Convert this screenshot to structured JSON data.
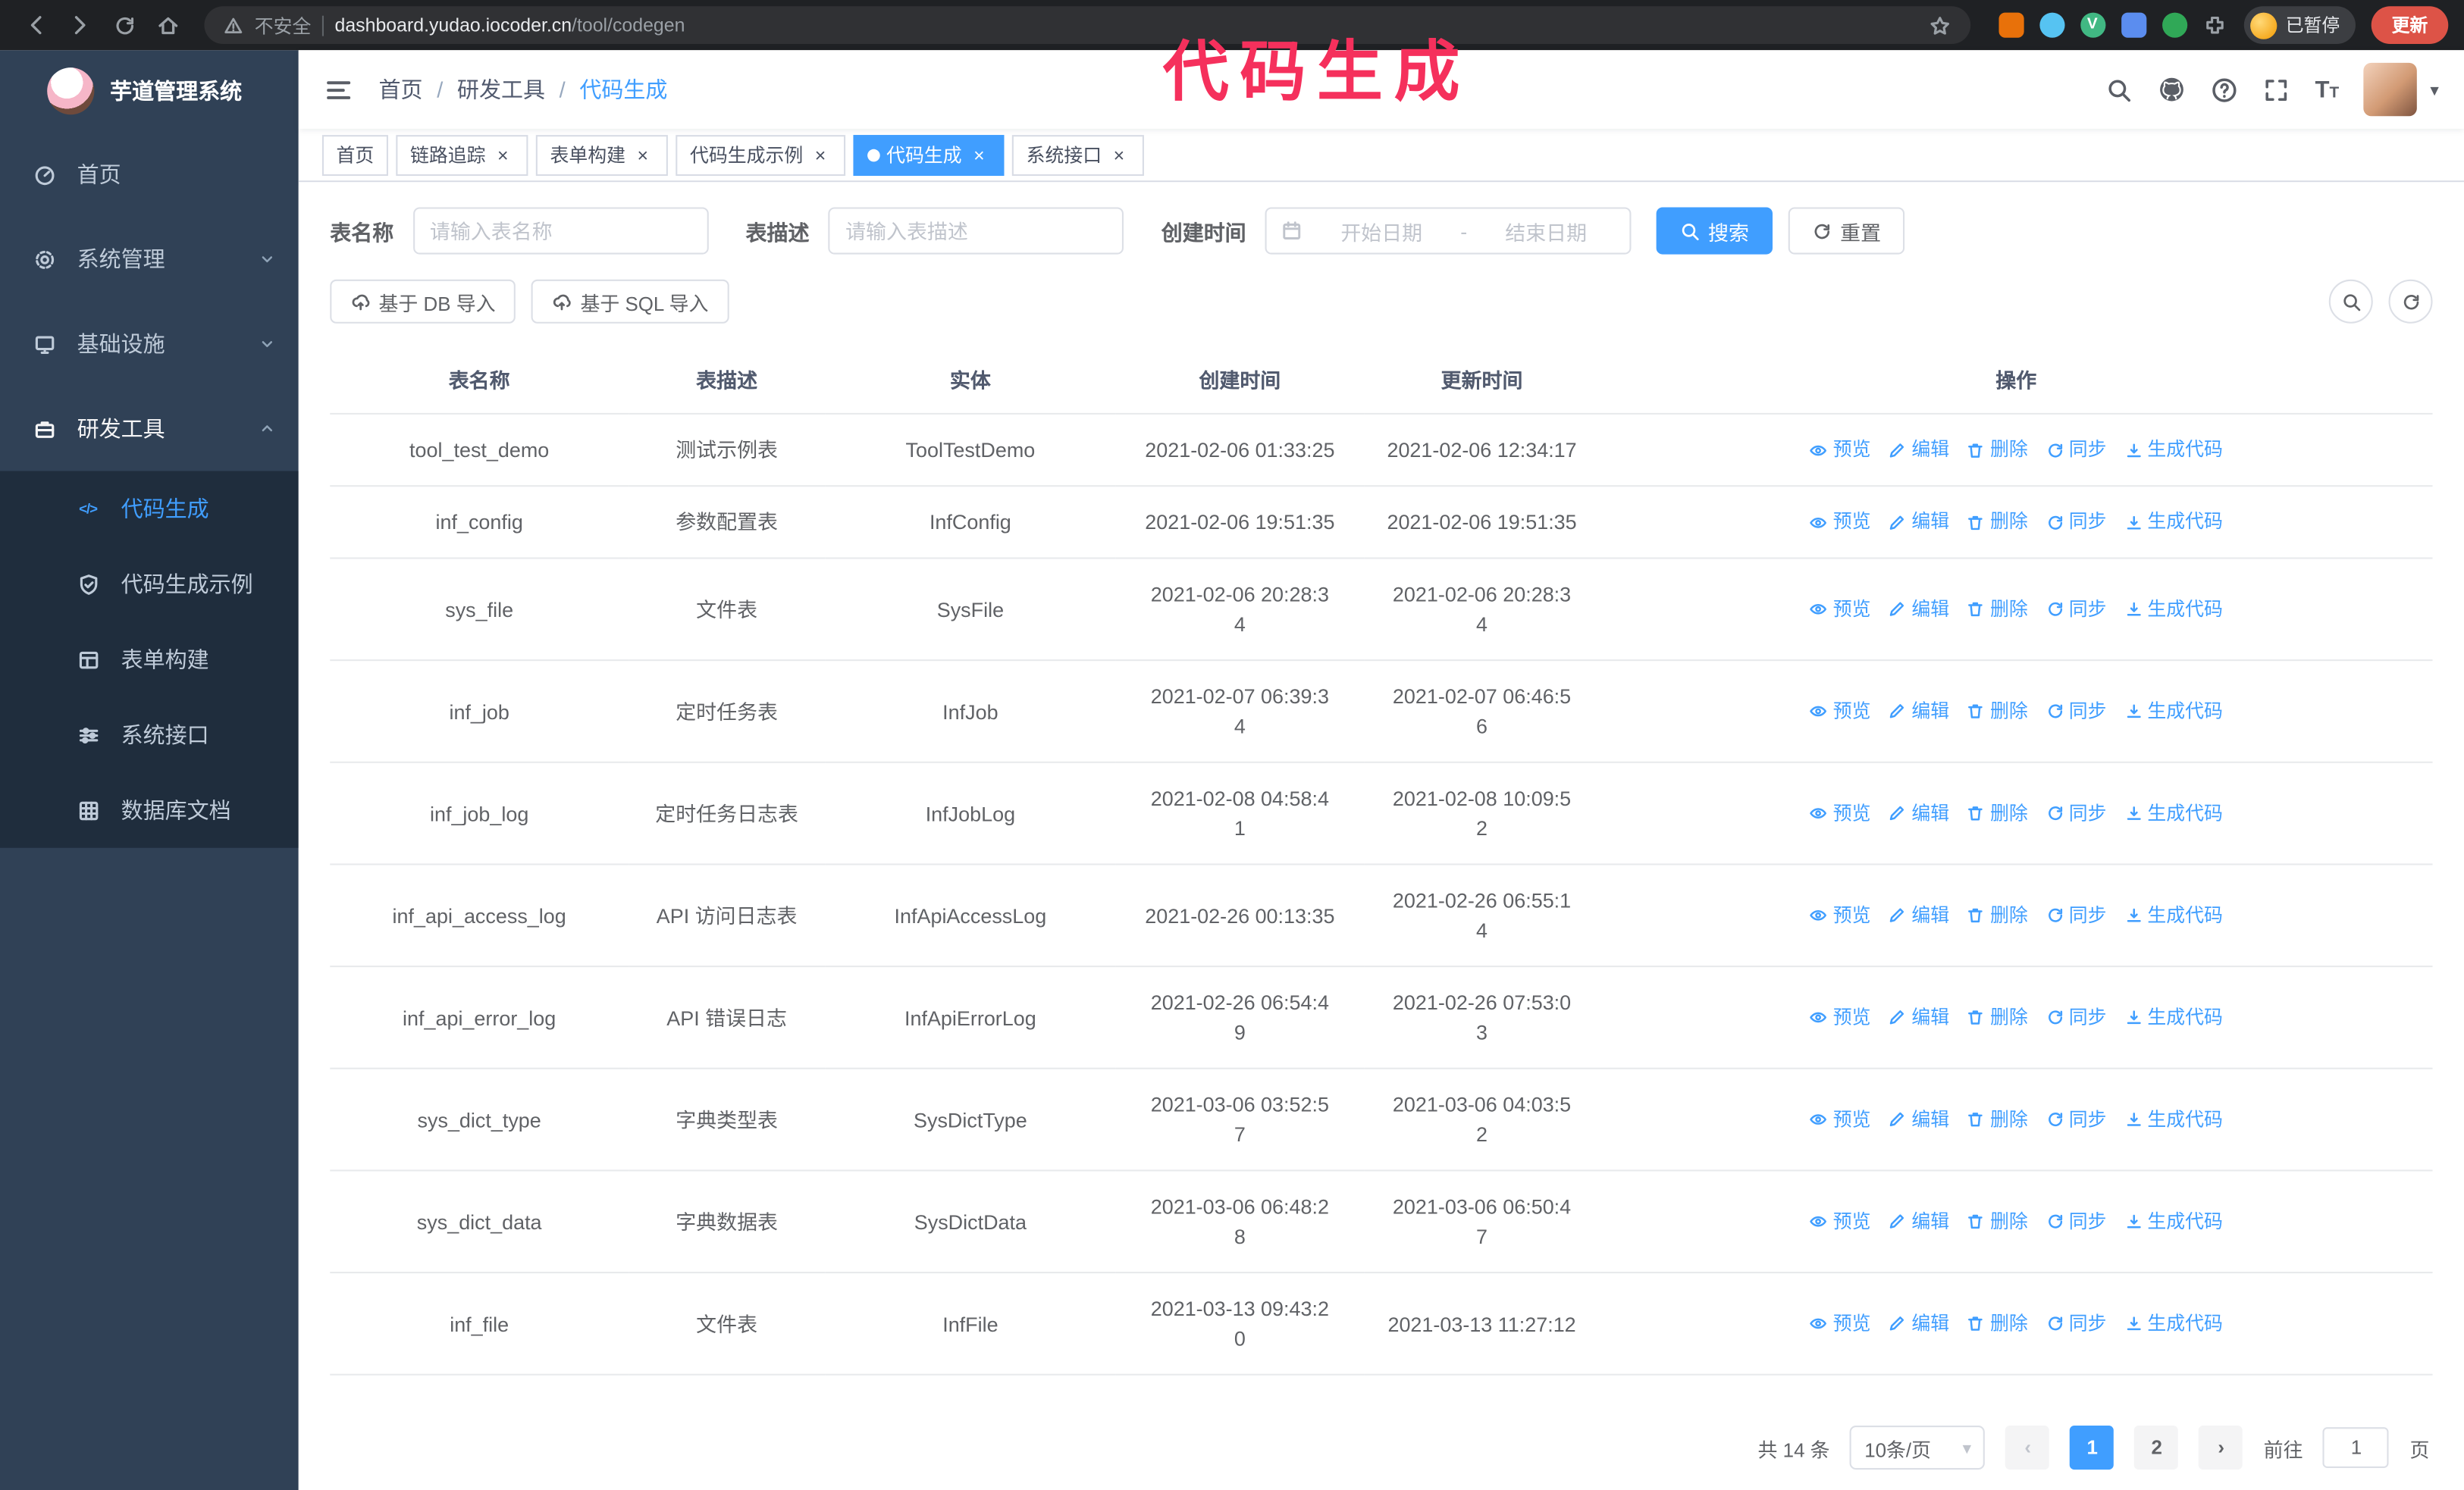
{
  "colors": {
    "accent": "#409eff",
    "sidebar_bg": "#304156",
    "submenu_bg": "#1f2d3d",
    "annotation": "#f5305c",
    "update_pill": "#dd5347"
  },
  "annotation": {
    "text": "代码生成"
  },
  "icons": {
    "close": "×",
    "caret_down": "▾",
    "separator_slash": "/",
    "dash": "-",
    "font_size": "T",
    "code": "</>",
    "vue": "V",
    "arrow_left": "‹",
    "arrow_right": "›"
  },
  "browser": {
    "security_label": "不安全",
    "url_host": "dashboard.yudao.iocoder.cn",
    "url_path": "/tool/codegen",
    "extension_colors": [
      "#e8710a",
      "#56c3f2",
      "#41b883",
      "#5b8def",
      "#30a857",
      "#9aa0a6"
    ],
    "profile_badge": "已暂停",
    "update_button": "更新"
  },
  "sidebar": {
    "app_title": "芋道管理系统",
    "items": [
      {
        "label": "首页"
      },
      {
        "label": "系统管理",
        "expandable": true
      },
      {
        "label": "基础设施",
        "expandable": true
      },
      {
        "label": "研发工具",
        "expandable": true,
        "expanded": true,
        "children": [
          {
            "label": "代码生成",
            "active": true
          },
          {
            "label": "代码生成示例"
          },
          {
            "label": "表单构建"
          },
          {
            "label": "系统接口"
          },
          {
            "label": "数据库文档"
          }
        ]
      }
    ]
  },
  "header": {
    "breadcrumb": [
      "首页",
      "研发工具",
      "代码生成"
    ]
  },
  "tabs": [
    {
      "label": "首页",
      "closable": false,
      "active": false
    },
    {
      "label": "链路追踪",
      "closable": true,
      "active": false
    },
    {
      "label": "表单构建",
      "closable": true,
      "active": false
    },
    {
      "label": "代码生成示例",
      "closable": true,
      "active": false
    },
    {
      "label": "代码生成",
      "closable": true,
      "active": true
    },
    {
      "label": "系统接口",
      "closable": true,
      "active": false
    }
  ],
  "filters": {
    "table_name_label": "表名称",
    "table_name_placeholder": "请输入表名称",
    "table_desc_label": "表描述",
    "table_desc_placeholder": "请输入表描述",
    "create_time_label": "创建时间",
    "date_start_placeholder": "开始日期",
    "date_end_placeholder": "结束日期",
    "search_button": "搜索",
    "reset_button": "重置"
  },
  "toolbar": {
    "import_db_button": "基于 DB 导入",
    "import_sql_button": "基于 SQL 导入"
  },
  "table": {
    "columns": [
      "表名称",
      "表描述",
      "实体",
      "创建时间",
      "更新时间",
      "操作"
    ],
    "actions": [
      "预览",
      "编辑",
      "删除",
      "同步",
      "生成代码"
    ],
    "rows": [
      {
        "name": "tool_test_demo",
        "desc": "测试示例表",
        "entity": "ToolTestDemo",
        "created": "2021-02-06 01:33:25",
        "updated": "2021-02-06 12:34:17"
      },
      {
        "name": "inf_config",
        "desc": "参数配置表",
        "entity": "InfConfig",
        "created": "2021-02-06 19:51:35",
        "updated": "2021-02-06 19:51:35"
      },
      {
        "name": "sys_file",
        "desc": "文件表",
        "entity": "SysFile",
        "created": "2021-02-06 20:28:3\n4",
        "updated": "2021-02-06 20:28:3\n4"
      },
      {
        "name": "inf_job",
        "desc": "定时任务表",
        "entity": "InfJob",
        "created": "2021-02-07 06:39:3\n4",
        "updated": "2021-02-07 06:46:5\n6"
      },
      {
        "name": "inf_job_log",
        "desc": "定时任务日志表",
        "entity": "InfJobLog",
        "created": "2021-02-08 04:58:4\n1",
        "updated": "2021-02-08 10:09:5\n2"
      },
      {
        "name": "inf_api_access_log",
        "desc": "API 访问日志表",
        "entity": "InfApiAccessLog",
        "created": "2021-02-26 00:13:35",
        "updated": "2021-02-26 06:55:1\n4"
      },
      {
        "name": "inf_api_error_log",
        "desc": "API 错误日志",
        "entity": "InfApiErrorLog",
        "created": "2021-02-26 06:54:4\n9",
        "updated": "2021-02-26 07:53:0\n3"
      },
      {
        "name": "sys_dict_type",
        "desc": "字典类型表",
        "entity": "SysDictType",
        "created": "2021-03-06 03:52:5\n7",
        "updated": "2021-03-06 04:03:5\n2"
      },
      {
        "name": "sys_dict_data",
        "desc": "字典数据表",
        "entity": "SysDictData",
        "created": "2021-03-06 06:48:2\n8",
        "updated": "2021-03-06 06:50:4\n7"
      },
      {
        "name": "inf_file",
        "desc": "文件表",
        "entity": "InfFile",
        "created": "2021-03-13 09:43:2\n0",
        "updated": "2021-03-13 11:27:12"
      }
    ]
  },
  "pagination": {
    "total_text": "共 14 条",
    "page_size": "10条/页",
    "pages": [
      "1",
      "2"
    ],
    "active_page": "1",
    "goto_label": "前往",
    "goto_value": "1",
    "goto_suffix": "页"
  }
}
